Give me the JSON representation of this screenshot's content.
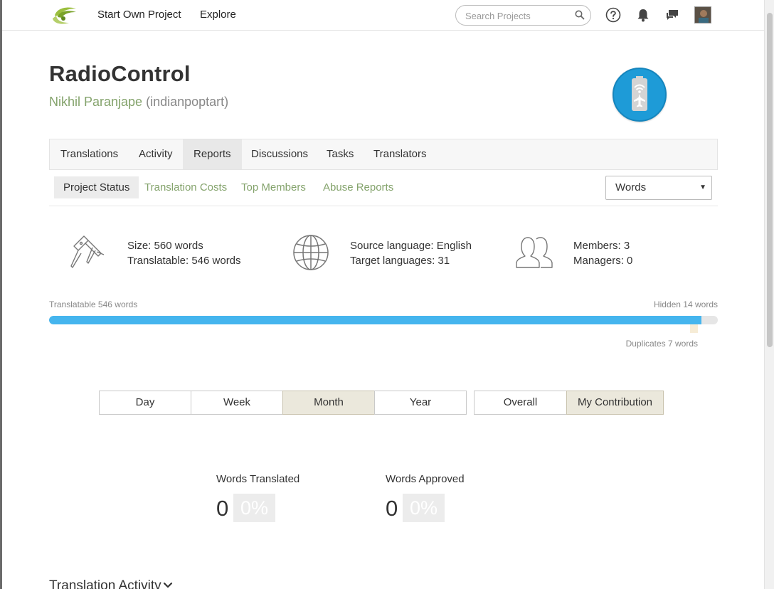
{
  "nav": {
    "start_project": "Start Own Project",
    "explore": "Explore",
    "search_placeholder": "Search Projects"
  },
  "project": {
    "title": "RadioControl",
    "owner_name": "Nikhil Paranjape",
    "owner_handle": "(indianpoptart)"
  },
  "tabs": [
    {
      "label": "Translations"
    },
    {
      "label": "Activity"
    },
    {
      "label": "Reports"
    },
    {
      "label": "Discussions"
    },
    {
      "label": "Tasks"
    },
    {
      "label": "Translators"
    }
  ],
  "subtabs": [
    {
      "label": "Project Status"
    },
    {
      "label": "Translation Costs"
    },
    {
      "label": "Top Members"
    },
    {
      "label": "Abuse Reports"
    }
  ],
  "unit_select": {
    "value": "Words"
  },
  "stats": {
    "size": "Size: 560 words",
    "translatable": "Translatable: 546 words",
    "source_language": "Source language: English",
    "target_languages": "Target languages: 31",
    "members": "Members: 3",
    "managers": "Managers: 0"
  },
  "progress": {
    "left_label": "Translatable 546 words",
    "right_label": "Hidden 14 words",
    "duplicates_label": "Duplicates 7 words",
    "translatable_fraction": 0.975
  },
  "periods": [
    {
      "label": "Day"
    },
    {
      "label": "Week"
    },
    {
      "label": "Month"
    },
    {
      "label": "Year"
    }
  ],
  "scopes": [
    {
      "label": "Overall"
    },
    {
      "label": "My Contribution"
    }
  ],
  "metrics": {
    "translated_label": "Words Translated",
    "translated_value": "0",
    "translated_pct": "0%",
    "approved_label": "Words Approved",
    "approved_value": "0",
    "approved_pct": "0%"
  },
  "section": {
    "translation_activity": "Translation Activity"
  },
  "colors": {
    "accent_green": "#84a36c",
    "progress_blue": "#45b5ee",
    "project_icon_bg": "#1e9bd7"
  }
}
